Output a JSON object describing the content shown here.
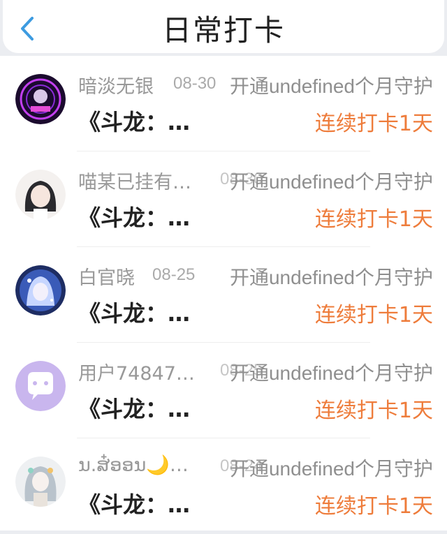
{
  "header": {
    "title": "日常打卡"
  },
  "rows": [
    {
      "name": "暗淡无银",
      "date": "08-30",
      "guard": "开通undefined个月守护",
      "book": "《斗龙：…",
      "streak": "连续打卡1天",
      "avatar": "avatar-1"
    },
    {
      "name": "喵某已挂有…",
      "date": "08-30",
      "guard": "开通undefined个月守护",
      "book": "《斗龙：…",
      "streak": "连续打卡1天",
      "avatar": "avatar-2"
    },
    {
      "name": "白官晓",
      "date": "08-25",
      "guard": "开通undefined个月守护",
      "book": "《斗龙：…",
      "streak": "连续打卡1天",
      "avatar": "avatar-3"
    },
    {
      "name": "用户748470…",
      "date": "08-25",
      "guard": "开通undefined个月守护",
      "book": "《斗龙：…",
      "streak": "连续打卡1天",
      "avatar": "avatar-4"
    },
    {
      "name": "ນ.ສ໋ອອນ🌙…",
      "date": "08-24",
      "guard": "开通undefined个月守护",
      "book": "《斗龙：…",
      "streak": "连续打卡1天",
      "avatar": "avatar-5"
    }
  ],
  "colors": {
    "accent": "#ee7c3b",
    "back": "#3d9be0"
  }
}
